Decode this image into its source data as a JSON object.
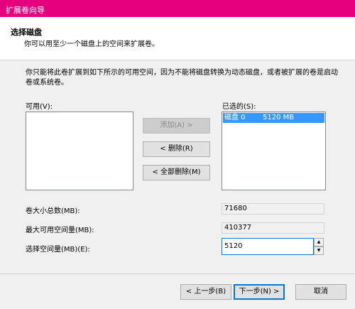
{
  "window": {
    "title": "扩展卷向导"
  },
  "header": {
    "title": "选择磁盘",
    "subtitle": "你可以用至少一个磁盘上的空间来扩展卷。"
  },
  "description": "你只能将此卷扩展到如下所示的可用空间，因为不能将磁盘转换为动态磁盘，或者被扩展的卷是启动卷或系统卷。",
  "available": {
    "label": "可用(V):",
    "items": []
  },
  "selected": {
    "label": "已选的(S):",
    "items": [
      {
        "disk": "磁盘 0",
        "size": "5120 MB"
      }
    ]
  },
  "buttons": {
    "add": "添加(A) >",
    "remove": "< 删除(R)",
    "remove_all": "< 全部删除(M)"
  },
  "fields": {
    "total_label": "卷大小总数(MB):",
    "total_value": "71680",
    "max_label": "最大可用空间量(MB):",
    "max_value": "410377",
    "select_label": "选择空间量(MB)(E):",
    "select_value": "5120"
  },
  "footer": {
    "back": "< 上一步(B)",
    "next": "下一步(N) >",
    "cancel": "取消"
  }
}
